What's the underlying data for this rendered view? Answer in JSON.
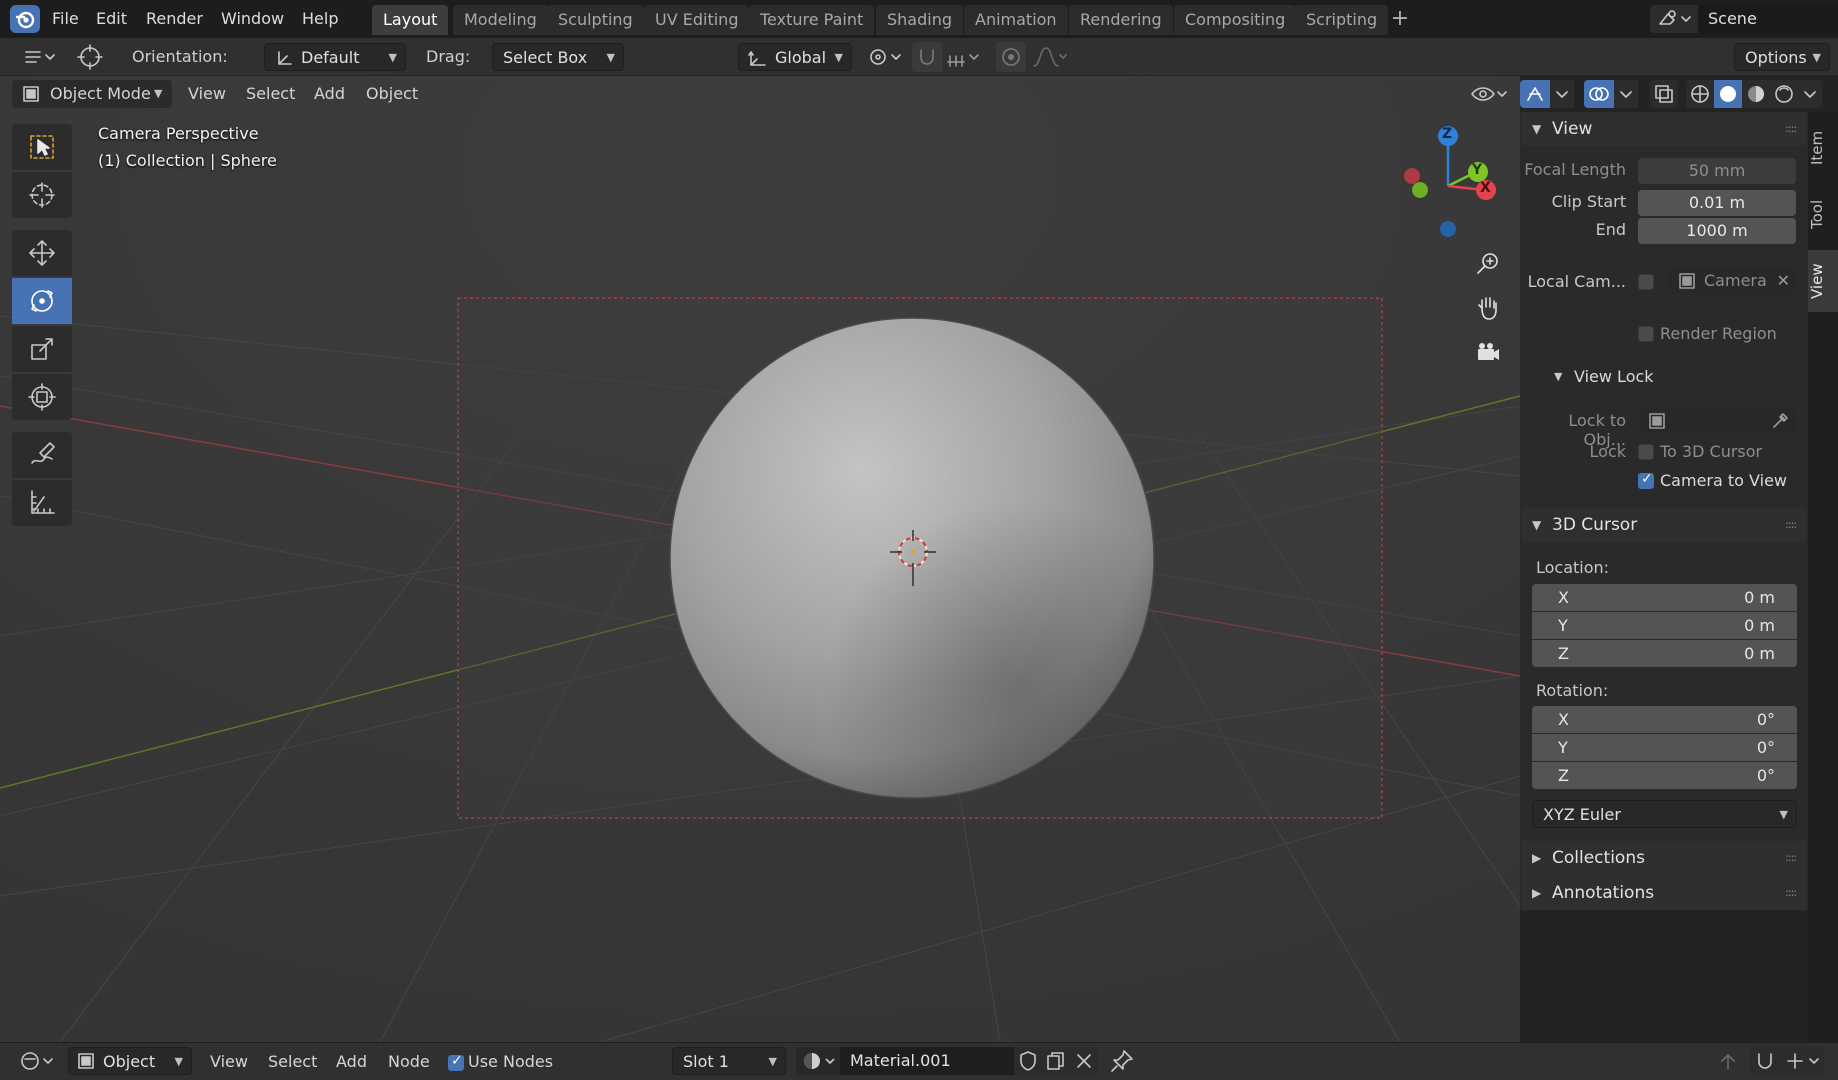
{
  "topbar": {
    "menus": [
      "File",
      "Edit",
      "Render",
      "Window",
      "Help"
    ],
    "workspaces": [
      "Layout",
      "Modeling",
      "Sculpting",
      "UV Editing",
      "Texture Paint",
      "Shading",
      "Animation",
      "Rendering",
      "Compositing",
      "Scripting"
    ],
    "active_workspace": "Layout",
    "scene_label": "Scene"
  },
  "toolheader": {
    "orientation_label": "Orientation:",
    "orientation_value": "Default",
    "drag_label": "Drag:",
    "drag_value": "Select Box",
    "transform_orientation": "Global",
    "options_label": "Options"
  },
  "viewheader": {
    "mode": "Object Mode",
    "menus": [
      "View",
      "Select",
      "Add",
      "Object"
    ]
  },
  "viewport": {
    "overlay_line1": "Camera Perspective",
    "overlay_line2": "(1) Collection | Sphere",
    "gizmo_axes": [
      "Z",
      "Y",
      "X"
    ],
    "colors": {
      "x_axis": "#e0454f",
      "y_axis": "#7ec627",
      "z_axis": "#2f80d8",
      "selection": "#4772b3"
    }
  },
  "sidebar": {
    "tabs": [
      "Item",
      "Tool",
      "View"
    ],
    "active_tab": "View",
    "view_panel": {
      "title": "View",
      "focal_length_label": "Focal Length",
      "focal_length_value": "50 mm",
      "clip_start_label": "Clip Start",
      "clip_start_value": "0.01 m",
      "clip_end_label": "End",
      "clip_end_value": "1000 m",
      "local_camera_label": "Local Cam...",
      "local_camera_value": "Camera",
      "render_region_label": "Render Region",
      "view_lock_title": "View Lock",
      "lock_to_object_label": "Lock to Obj...",
      "lock_label": "Lock",
      "to_3d_cursor_label": "To 3D Cursor",
      "camera_to_view_label": "Camera to View",
      "camera_to_view_checked": true
    },
    "cursor_panel": {
      "title": "3D Cursor",
      "location_label": "Location:",
      "location": [
        {
          "axis": "X",
          "value": "0 m"
        },
        {
          "axis": "Y",
          "value": "0 m"
        },
        {
          "axis": "Z",
          "value": "0 m"
        }
      ],
      "rotation_label": "Rotation:",
      "rotation": [
        {
          "axis": "X",
          "value": "0°"
        },
        {
          "axis": "Y",
          "value": "0°"
        },
        {
          "axis": "Z",
          "value": "0°"
        }
      ],
      "rotation_mode": "XYZ Euler"
    },
    "collections_title": "Collections",
    "annotations_title": "Annotations"
  },
  "bottombar": {
    "object_label": "Object",
    "menus": [
      "View",
      "Select",
      "Add",
      "Node"
    ],
    "use_nodes_label": "Use Nodes",
    "use_nodes_checked": true,
    "slot_label": "Slot 1",
    "material_name": "Material.001"
  }
}
